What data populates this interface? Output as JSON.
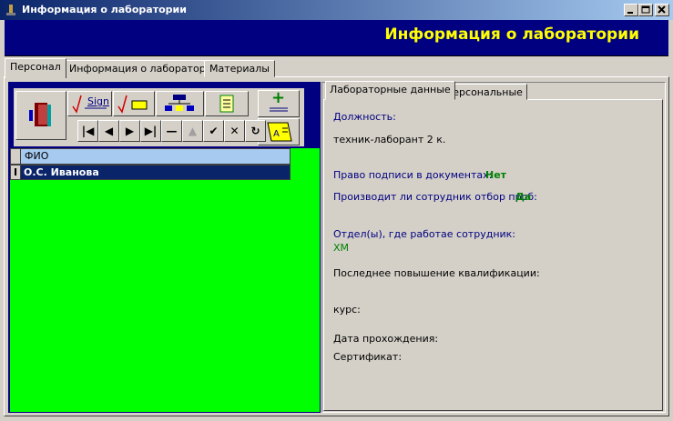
{
  "window": {
    "title": "Информация о лаборатории",
    "controls": [
      "minimize",
      "maximize",
      "close"
    ]
  },
  "header": {
    "title": "Информация о лаборатории",
    "color": "#ffff00",
    "background": "#000080"
  },
  "tabs": [
    {
      "label": "Персонал",
      "active": true
    },
    {
      "label": "Информация о лаборатории",
      "active": false
    },
    {
      "label": "Материалы",
      "active": false
    }
  ],
  "toolbar": {
    "sign_label": "Sign",
    "nav_glyphs": {
      "first": "|◀",
      "prev": "◀",
      "next": "▶",
      "last": "▶|",
      "delete": "—",
      "up": "▲",
      "post": "✔",
      "cancel": "✕",
      "refresh": "↻"
    },
    "add_glyph": "+"
  },
  "grid": {
    "columns": [
      "ФИО"
    ],
    "rows": [
      {
        "indicator": "I",
        "fio": "О.С. Иванова",
        "selected": true
      }
    ],
    "background": "#00ff00"
  },
  "right_tabs": [
    {
      "label": "Лабораторные данные",
      "active": true
    },
    {
      "label": "Персональные",
      "active": false
    }
  ],
  "details": {
    "position_label": "Должность:",
    "position_value": "техник-лаборант 2 к.",
    "sign_right_label": "Право подписи в документах:",
    "sign_right_value": "Нет",
    "sampling_label": "Производит ли сотрудник отбор проб:",
    "sampling_value": "Да",
    "department_label": "Отдел(ы), где работае сотрудник:",
    "department_value": "ХМ",
    "qualification_label": "Последнее повышение квалификации:",
    "course_label": "курс:",
    "date_label": "Дата прохождения:",
    "certificate_label": "Сертификат:"
  }
}
